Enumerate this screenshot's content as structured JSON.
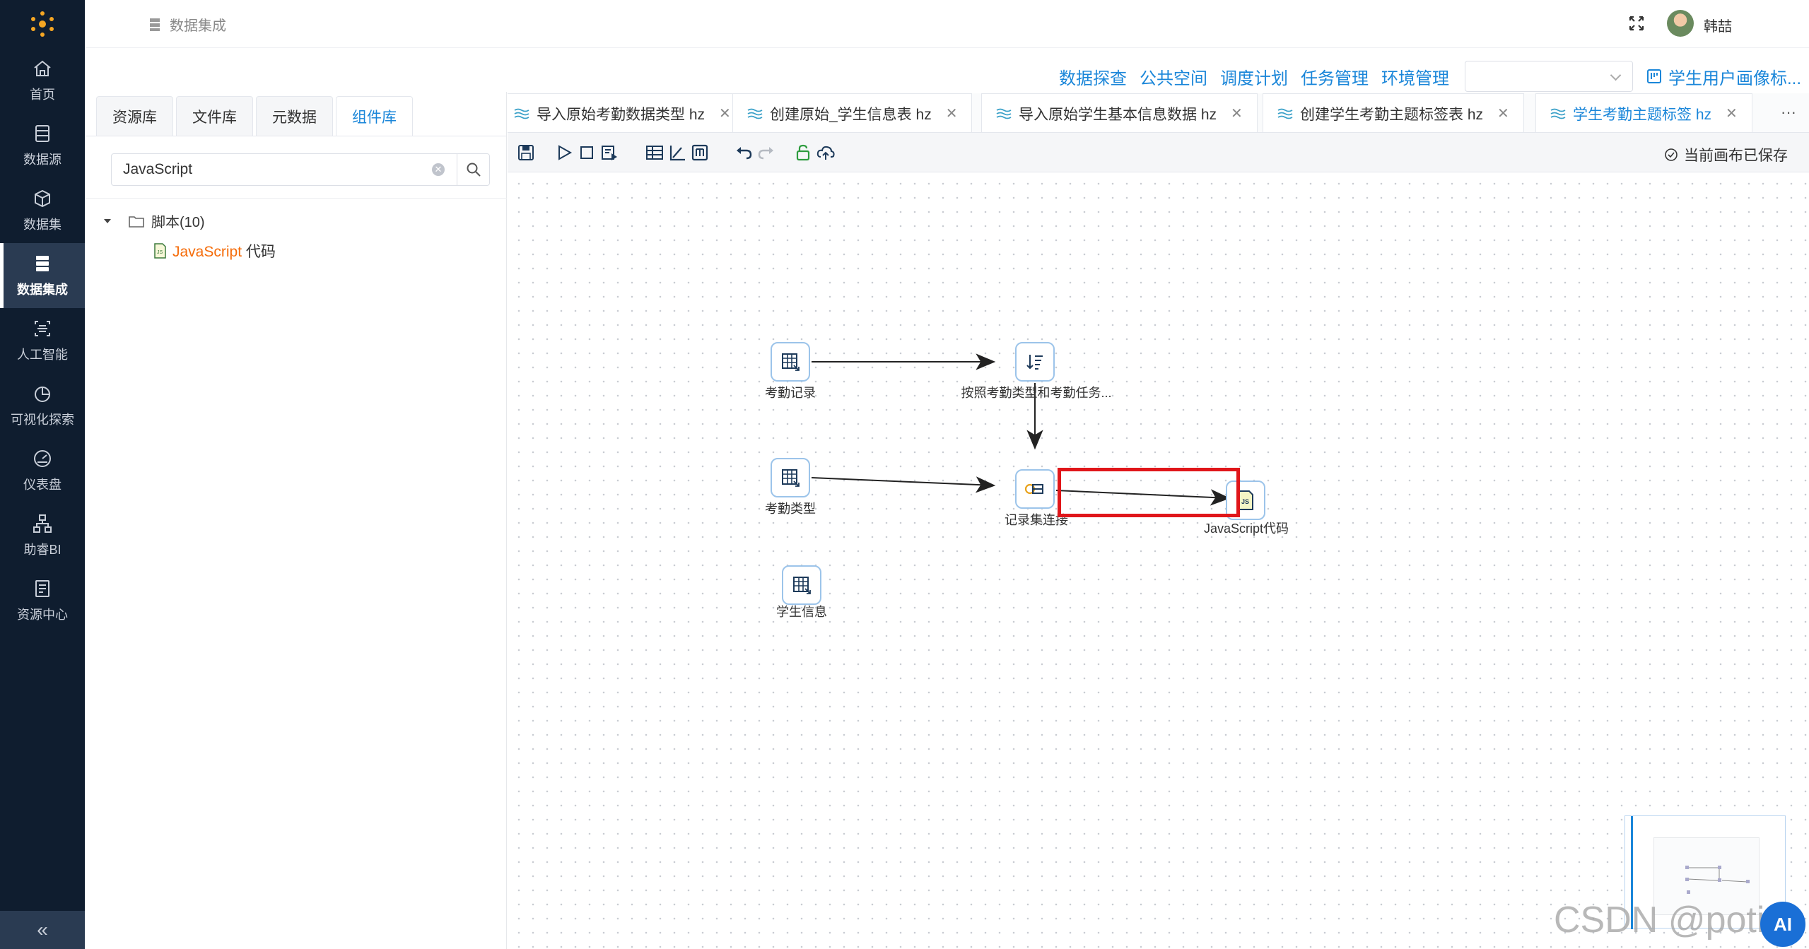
{
  "nav": {
    "items": [
      {
        "label": "首页",
        "icon": "home-icon"
      },
      {
        "label": "数据源",
        "icon": "database-icon"
      },
      {
        "label": "数据集",
        "icon": "cube-icon"
      },
      {
        "label": "数据集成",
        "icon": "server-icon",
        "active": true
      },
      {
        "label": "人工智能",
        "icon": "ai-icon"
      },
      {
        "label": "可视化探索",
        "icon": "pie-chart-icon"
      },
      {
        "label": "仪表盘",
        "icon": "gauge-icon"
      },
      {
        "label": "助睿BI",
        "icon": "org-chart-icon"
      },
      {
        "label": "资源中心",
        "icon": "document-icon"
      }
    ],
    "collapse": "«"
  },
  "header": {
    "breadcrumb": "数据集成",
    "user": "韩喆"
  },
  "links": {
    "items": [
      "数据探查",
      "公共空间",
      "调度计划",
      "任务管理",
      "环境管理"
    ],
    "select_value": "",
    "portrait": "学生用户画像标..."
  },
  "panel": {
    "tabs": [
      "资源库",
      "文件库",
      "元数据",
      "组件库"
    ],
    "active_tab": "组件库",
    "search_value": "JavaScript",
    "tree_folder": "脚本(10)",
    "tree_item_highlight": "JavaScript",
    "tree_item_rest": " 代码"
  },
  "file_tabs": [
    {
      "label": "导入原始考勤数据类型 hz",
      "close": "✕"
    },
    {
      "label": "创建原始_学生信息表 hz",
      "close": "✕"
    },
    {
      "label": "导入原始学生基本信息数据 hz",
      "close": "✕"
    },
    {
      "label": "创建学生考勤主题标签表 hz",
      "close": "✕"
    },
    {
      "label": "学生考勤主题标签 hz",
      "close": "✕",
      "active": true
    }
  ],
  "file_tabs_more": "···",
  "toolbar": {
    "saved_text": "当前画布已保存"
  },
  "canvas": {
    "nodes": [
      {
        "label": "考勤记录",
        "icon": "table-input-icon"
      },
      {
        "label": "按照考勤类型和考勤任务...",
        "icon": "sort-icon"
      },
      {
        "label": "考勤类型",
        "icon": "table-input-icon"
      },
      {
        "label": "记录集连接",
        "icon": "join-icon"
      },
      {
        "label": "JavaScript代码",
        "icon": "javascript-icon"
      },
      {
        "label": "学生信息",
        "icon": "table-input-icon"
      }
    ]
  },
  "watermark": "CSDN @potion",
  "ai_button": "AI",
  "colors": {
    "nav_bg": "#0f1d2f",
    "accent": "#1a86d9",
    "highlight_box": "#e0161a",
    "search_highlight": "#f56c0a"
  }
}
